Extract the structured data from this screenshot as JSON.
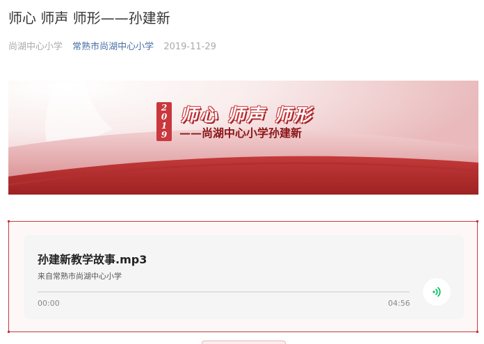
{
  "article": {
    "title": "师心 师声 师形——孙建新",
    "author": "尚湖中心小学",
    "account": "常熟市尚湖中心小学",
    "date": "2019-11-29"
  },
  "banner": {
    "year_digits": [
      "2",
      "0",
      "1",
      "9"
    ],
    "title": "师心  师声  师形",
    "subtitle": "——尚湖中心小学孙建新",
    "colors": {
      "primary": "#c8383c",
      "dark": "#8a1418",
      "band": "#ac2a2a"
    }
  },
  "audio": {
    "title": "孙建新教学故事.mp3",
    "source": "来自常熟市尚湖中心小学",
    "current_time": "00:00",
    "duration": "04:56",
    "progress": 0,
    "play_icon": "sound-wave-icon",
    "accent": "#07c160"
  }
}
